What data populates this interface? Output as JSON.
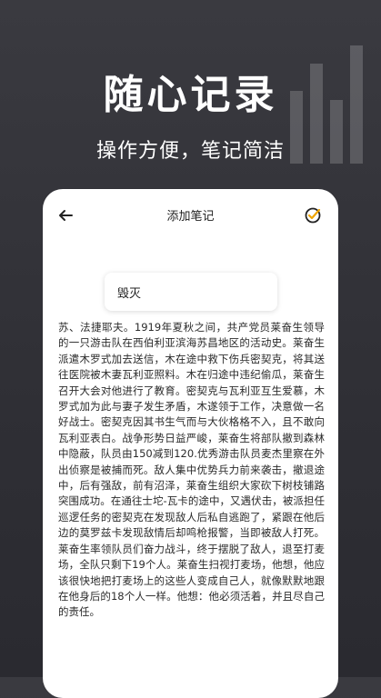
{
  "hero": {
    "title": "随心记录",
    "subtitle": "操作方便，笔记简洁"
  },
  "nav": {
    "title": "添加笔记",
    "back_icon": "arrow-left-icon",
    "confirm_icon": "check-circle-icon"
  },
  "note": {
    "title": "毁灭",
    "content": "苏、法捷耶夫。1919年夏秋之间，共产党员莱奋生领导的一只游击队在西伯利亚滨海苏昌地区的活动史。莱奋生派遣木罗式加去送信，木在途中救下伤兵密契克，将其送往医院被木妻瓦利亚照料。木在归途中违纪偷瓜，莱奋生召开大会对他进行了教育。密契克与瓦利亚互生爱慕，木罗式加为此与妻子发生矛盾，木遂领于工作，决意做一名好战士。密契克因其书生气而与大伙格格不入，且不敢向瓦利亚表白。战争形势日益严峻，莱奋生将部队撤到森林中隐蔽，队员由150减到120.优秀游击队员麦杰里察在外出侦察是被捕而死。敌人集中优势兵力前来袭击，撤退途中，后有强敌，前有沼泽，莱奋生组织大家砍下树枝铺路突围成功。在通往士坨-瓦卡的途中，又遇伏击，被派担任巡逻任务的密契克在发现敌人后私自逃跑了，紧跟在他后边的莫罗兹卡发现敌情后却鸣枪报警，当即被敌人打死。莱奋生率领队员们奋力战斗，终于摆脱了敌人，退至打麦场，全队只剩下19个人。莱奋生扫视打麦场，他想，他应该很快地把打麦场上的这些人变成自己人，就像默默地跟在他身后的18个人一样。他想：他必须活着，并且尽自己的责任。"
  },
  "colors": {
    "background": "#2f2f35",
    "card": "#ffffff",
    "accent": "#f0a500"
  }
}
